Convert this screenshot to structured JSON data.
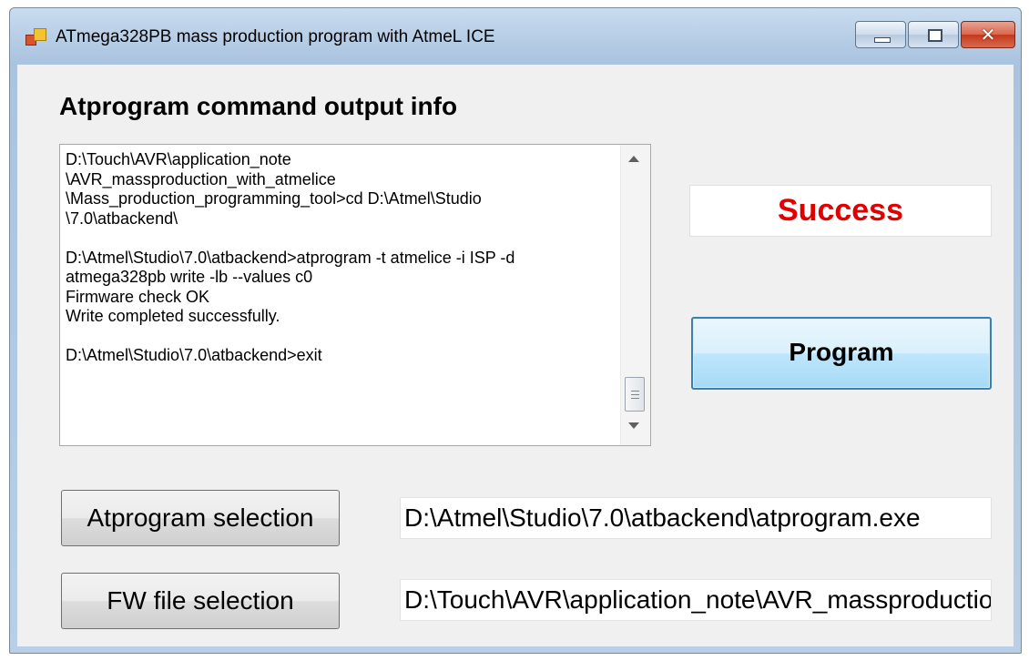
{
  "window": {
    "title": "ATmega328PB mass production program with AtmeL ICE",
    "controls": {
      "minimize": "minimize-icon",
      "maximize": "maximize-icon",
      "close": "close-icon",
      "close_glyph": "✕"
    }
  },
  "main": {
    "heading": "Atprogram command output info",
    "output_text": "D:\\Touch\\AVR\\application_note\n\\AVR_massproduction_with_atmelice\n\\Mass_production_programming_tool>cd D:\\Atmel\\Studio\n\\7.0\\atbackend\\\n\nD:\\Atmel\\Studio\\7.0\\atbackend>atprogram -t atmelice -i ISP -d\natmega328pb write -lb --values c0\nFirmware check OK\nWrite completed successfully.\n\nD:\\Atmel\\Studio\\7.0\\atbackend>exit",
    "status": "Success",
    "status_color": "#e00000",
    "program_button": "Program",
    "atprogram_button": "Atprogram selection",
    "atprogram_path": "D:\\Atmel\\Studio\\7.0\\atbackend\\atprogram.exe",
    "fw_button": "FW file selection",
    "fw_path": "D:\\Touch\\AVR\\application_note\\AVR_massproduction_with_atmelice"
  }
}
